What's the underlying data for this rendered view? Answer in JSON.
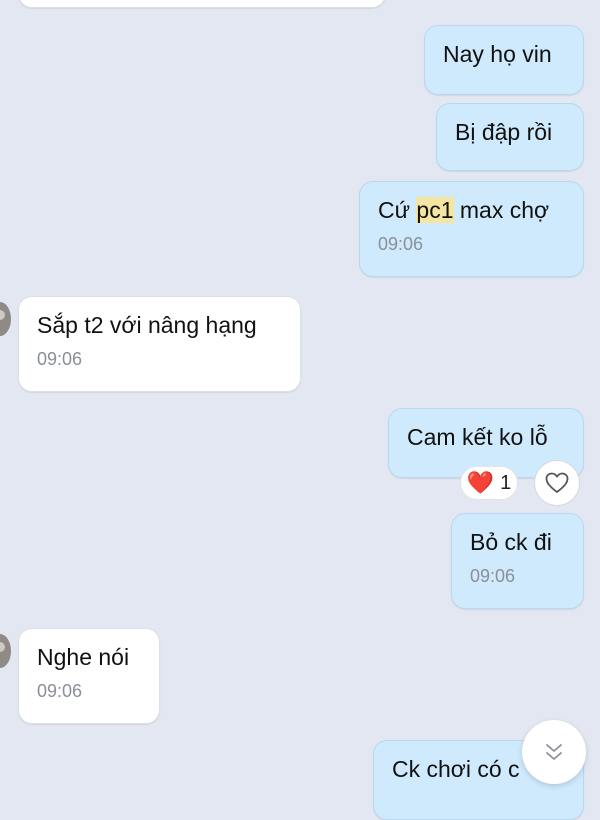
{
  "messages": [
    {
      "id": "m1",
      "dir": "out",
      "text": "Nay họ vin"
    },
    {
      "id": "m2",
      "dir": "out",
      "text": "Bị đập rồi"
    },
    {
      "id": "m3",
      "dir": "out",
      "pre": "Cứ ",
      "highlight": "pc1",
      "post": " max chợ",
      "time": "09:06"
    },
    {
      "id": "m4",
      "dir": "in",
      "text": "Sắp t2 với nâng hạng",
      "time": "09:06"
    },
    {
      "id": "m5",
      "dir": "out",
      "text": "Cam kết ko lỗ"
    },
    {
      "id": "m6",
      "dir": "out",
      "text": "Bỏ ck đi",
      "time": "09:06"
    },
    {
      "id": "m7",
      "dir": "in",
      "text": "Nghe nói",
      "time": "09:06"
    },
    {
      "id": "m8",
      "dir": "out",
      "text": "Ck chơi có c"
    }
  ],
  "reaction": {
    "emoji": "❤️",
    "count": "1"
  },
  "icons": {
    "react": "heart-outline-icon",
    "scroll": "double-chevron-down-icon"
  },
  "colors": {
    "background": "#e3e7f2",
    "outgoing": "#cfeafc",
    "incoming": "#ffffff",
    "highlight": "#f4e6a1"
  }
}
